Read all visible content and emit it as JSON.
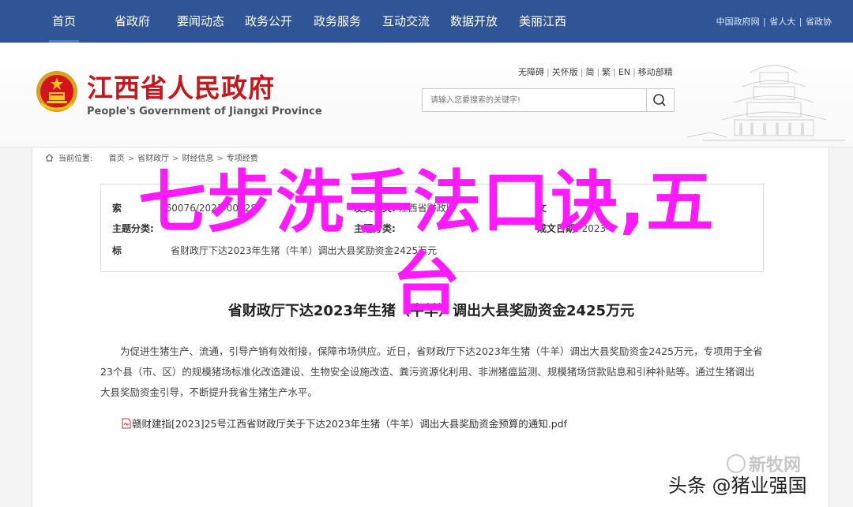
{
  "nav": {
    "items": [
      "首页",
      "省政府",
      "要闻动态",
      "政务公开",
      "政务服务",
      "互动交流",
      "数据开放",
      "美丽江西"
    ],
    "links": [
      "中国政府网",
      "省人大",
      "省政协"
    ]
  },
  "header": {
    "site_name_cn": "江西省人民政府",
    "site_name_en": "People's Government of Jiangxi Province",
    "tools": [
      "无障碍",
      "关怀版",
      "简",
      "繁",
      "EN",
      "移动部精"
    ],
    "search": {
      "placeholder": "请输入您要搜索的关键字!"
    }
  },
  "breadcrumb": {
    "prefix": "当前位置:",
    "items": [
      "首页",
      "省财政厅",
      "财经信息",
      "专项经费"
    ]
  },
  "meta": {
    "index_label": "索",
    "index_value": "360076/2023-00328",
    "issuer_label": "发文机关:",
    "issuer_value": "江西省财政厅",
    "docno_label": "文",
    "theme_label": "主题分类:",
    "date_label": "成文日期:",
    "date_value": "2023-0",
    "title_label": "标",
    "title_value": "省财政厅下达2023年生猪（牛羊）调出大县奖励资金2425万元"
  },
  "article": {
    "title": "省财政厅下达2023年生猪（牛羊）调出大县奖励资金2425万元",
    "paragraph": "为促进生猪生产、流通，引导产销有效衔接，保障市场供应。近日，省财政厅下达2023年生猪（牛羊）调出大县奖励资金2425万元，专项用于全省23个县（市、区）的规模猪场标准化改造建设、生物安全设施改造、粪污资源化利用、非洲猪瘟监测、规模猪场贷款贴息和引种补贴等。通过生猪调出大县奖励资金引导，不断提升我省生猪生产水平。",
    "attachment": "赣财建指[2023]25号江西省财政厅关于下达2023年生猪（牛羊）调出大县奖励资金预算的通知.pdf"
  },
  "overlay": {
    "line1": "七步洗手法口诀,五",
    "line2": "台",
    "color": "#ff19ff"
  },
  "watermark": {
    "logo_text": "新牧网",
    "source": "头条 @猪业强国"
  },
  "colors": {
    "nav_bg": "#2f5597",
    "brand_red": "#c8161d"
  }
}
